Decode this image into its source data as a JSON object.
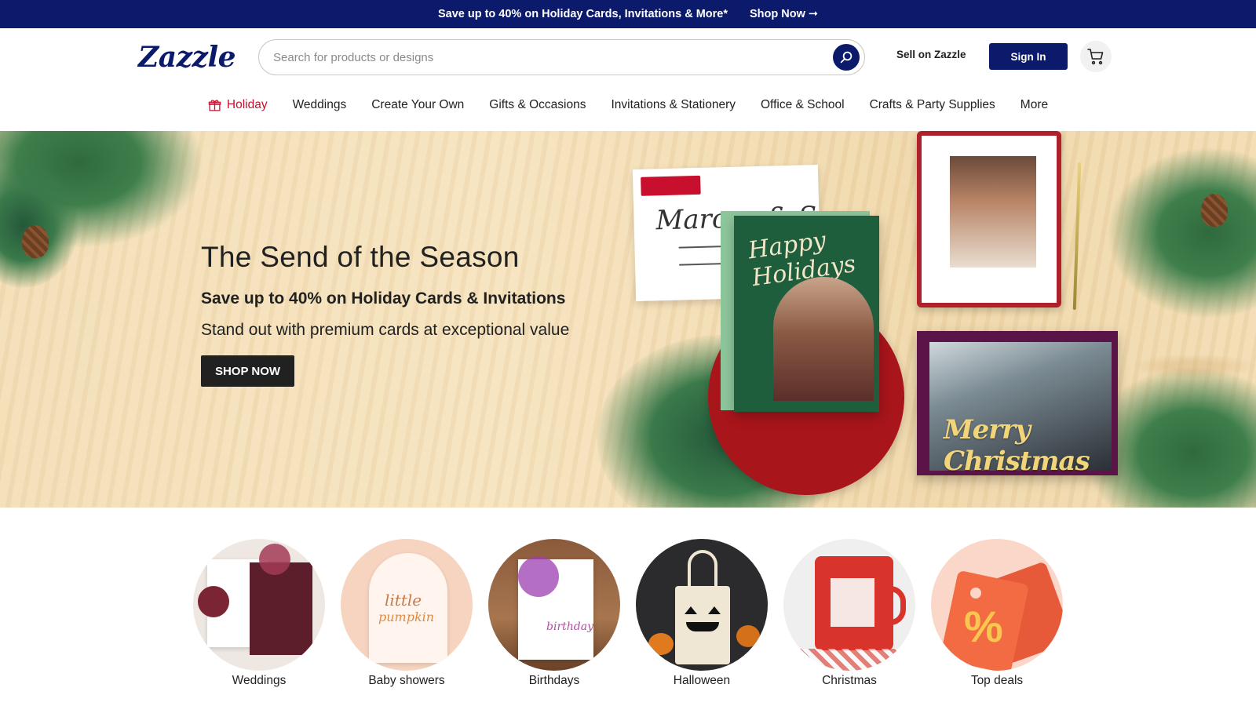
{
  "promo": {
    "text": "Save up to 40% on Holiday Cards, Invitations & More*",
    "link": "Shop Now ➞"
  },
  "header": {
    "logo": "Zazzle",
    "search_placeholder": "Search for products or designs",
    "sell_label": "Sell on Zazzle",
    "signin_label": "Sign In"
  },
  "nav": {
    "items": [
      {
        "label": "Holiday",
        "active": true
      },
      {
        "label": "Weddings"
      },
      {
        "label": "Create Your Own"
      },
      {
        "label": "Gifts & Occasions"
      },
      {
        "label": "Invitations & Stationery"
      },
      {
        "label": "Office & School"
      },
      {
        "label": "Crafts & Party Supplies"
      },
      {
        "label": "More"
      }
    ]
  },
  "hero": {
    "title": "The Send of the Season",
    "subtitle": "Save up to 40% on Holiday Cards & Invitations",
    "body": "Stand out with premium cards at exceptional value",
    "cta": "SHOP NOW",
    "envelope_name": "Marcus & S",
    "green_card_text": "Happy Holidays",
    "purple_card_text": "Merry Christmas"
  },
  "categories": [
    {
      "label": "Weddings"
    },
    {
      "label": "Baby showers"
    },
    {
      "label": "Birthdays"
    },
    {
      "label": "Halloween"
    },
    {
      "label": "Christmas"
    },
    {
      "label": "Top deals"
    }
  ],
  "colors": {
    "brand_navy": "#0b1a6b",
    "holiday_red": "#c8102e"
  }
}
